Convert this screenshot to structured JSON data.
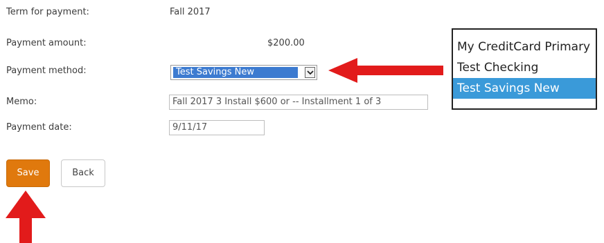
{
  "form": {
    "term_label": "Term for payment:",
    "term_value": "Fall 2017",
    "amount_label": "Payment amount:",
    "amount_value": "$200.00",
    "method_label": "Payment method:",
    "method_selected": "Test Savings New",
    "memo_label": "Memo:",
    "memo_value": "Fall 2017 3 Install $600 or  -- Installment 1 of 3",
    "date_label": "Payment date:",
    "date_value": "9/11/17"
  },
  "buttons": {
    "save": "Save",
    "back": "Back"
  },
  "dropdown_options": [
    "My CreditCard Primary",
    "Test Checking",
    "Test Savings New"
  ],
  "dropdown_selected_index": 2,
  "colors": {
    "save_button": "#e0790d",
    "selection_highlight": "#3a9ad9",
    "arrow": "#e21b1b"
  }
}
